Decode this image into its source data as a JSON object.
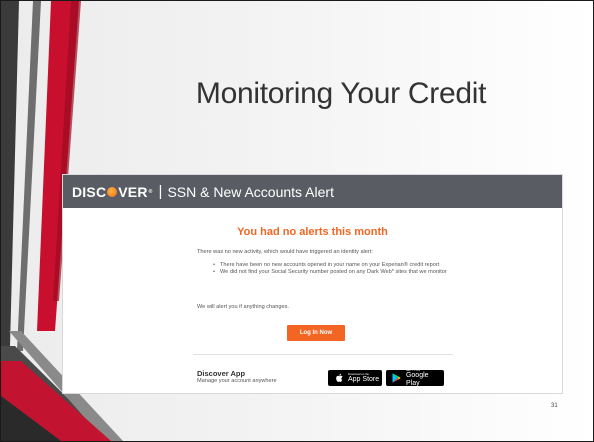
{
  "slide": {
    "title": "Monitoring Your Credit",
    "page_number": "31"
  },
  "email": {
    "logo_pre": "DISC",
    "logo_post": "VER",
    "logo_tm": "®",
    "header_separator": "|",
    "header_title": "SSN & New Accounts Alert",
    "headline": "You had no alerts this month",
    "intro": "There was no new activity, which would have triggered an identity alert:",
    "bullets": [
      "There have been no new accounts opened in your name on your Experian® credit report",
      "We did not find your Social Security number posted on any Dark Web* sites that we monitor"
    ],
    "closing": "We will alert you if anything changes.",
    "login_button": "Log In Now",
    "app_title": "Discover App",
    "app_subtitle": "Manage your account anywhere",
    "appstore_small": "Download on the",
    "appstore_big": "App Store",
    "gplay_small": "GET IT ON",
    "gplay_big": "Google Play"
  },
  "colors": {
    "accent": "#f26522",
    "header_bg": "#595d63",
    "stripe_red": "#c8102e",
    "stripe_dark": "#3a3a3a"
  },
  "icons": [
    "apple-icon",
    "google-play-icon",
    "discover-orb-icon"
  ]
}
